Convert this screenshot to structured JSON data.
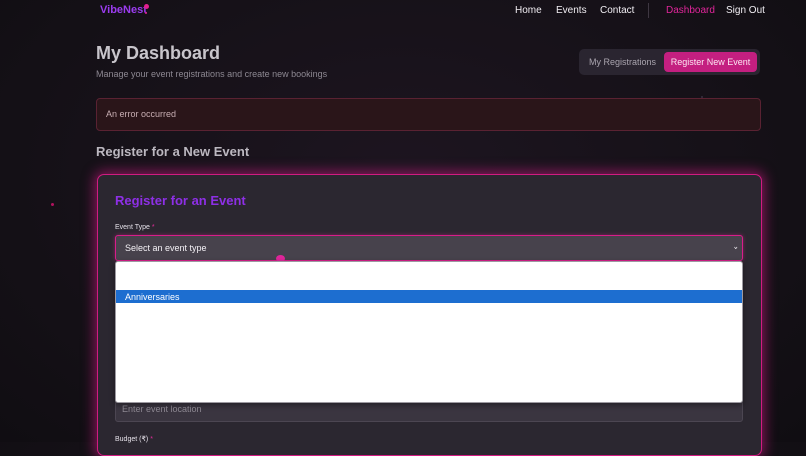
{
  "nav": {
    "brand": "VibeNest",
    "links": [
      "Home",
      "Events",
      "Contact"
    ],
    "dashboard": "Dashboard",
    "signout": "Sign Out"
  },
  "header": {
    "title": "My Dashboard",
    "subtitle": "Manage your event registrations and create new bookings"
  },
  "tabs": [
    "My Registrations",
    "Register New Event"
  ],
  "error": "An error occurred",
  "section_title": "Register for a New Event",
  "form": {
    "title": "Register for an Event",
    "event_type_label": "Event Type",
    "required": "*",
    "event_type_value": "Select an event type",
    "location_placeholder": "Enter event location",
    "budget_label": "Budget (₹)"
  },
  "dropdown": {
    "highlighted_option": "Anniversaries"
  },
  "colors": {
    "accent": "#d11b82",
    "brand": "#9b3cf0",
    "selection": "#1d6ed0"
  }
}
